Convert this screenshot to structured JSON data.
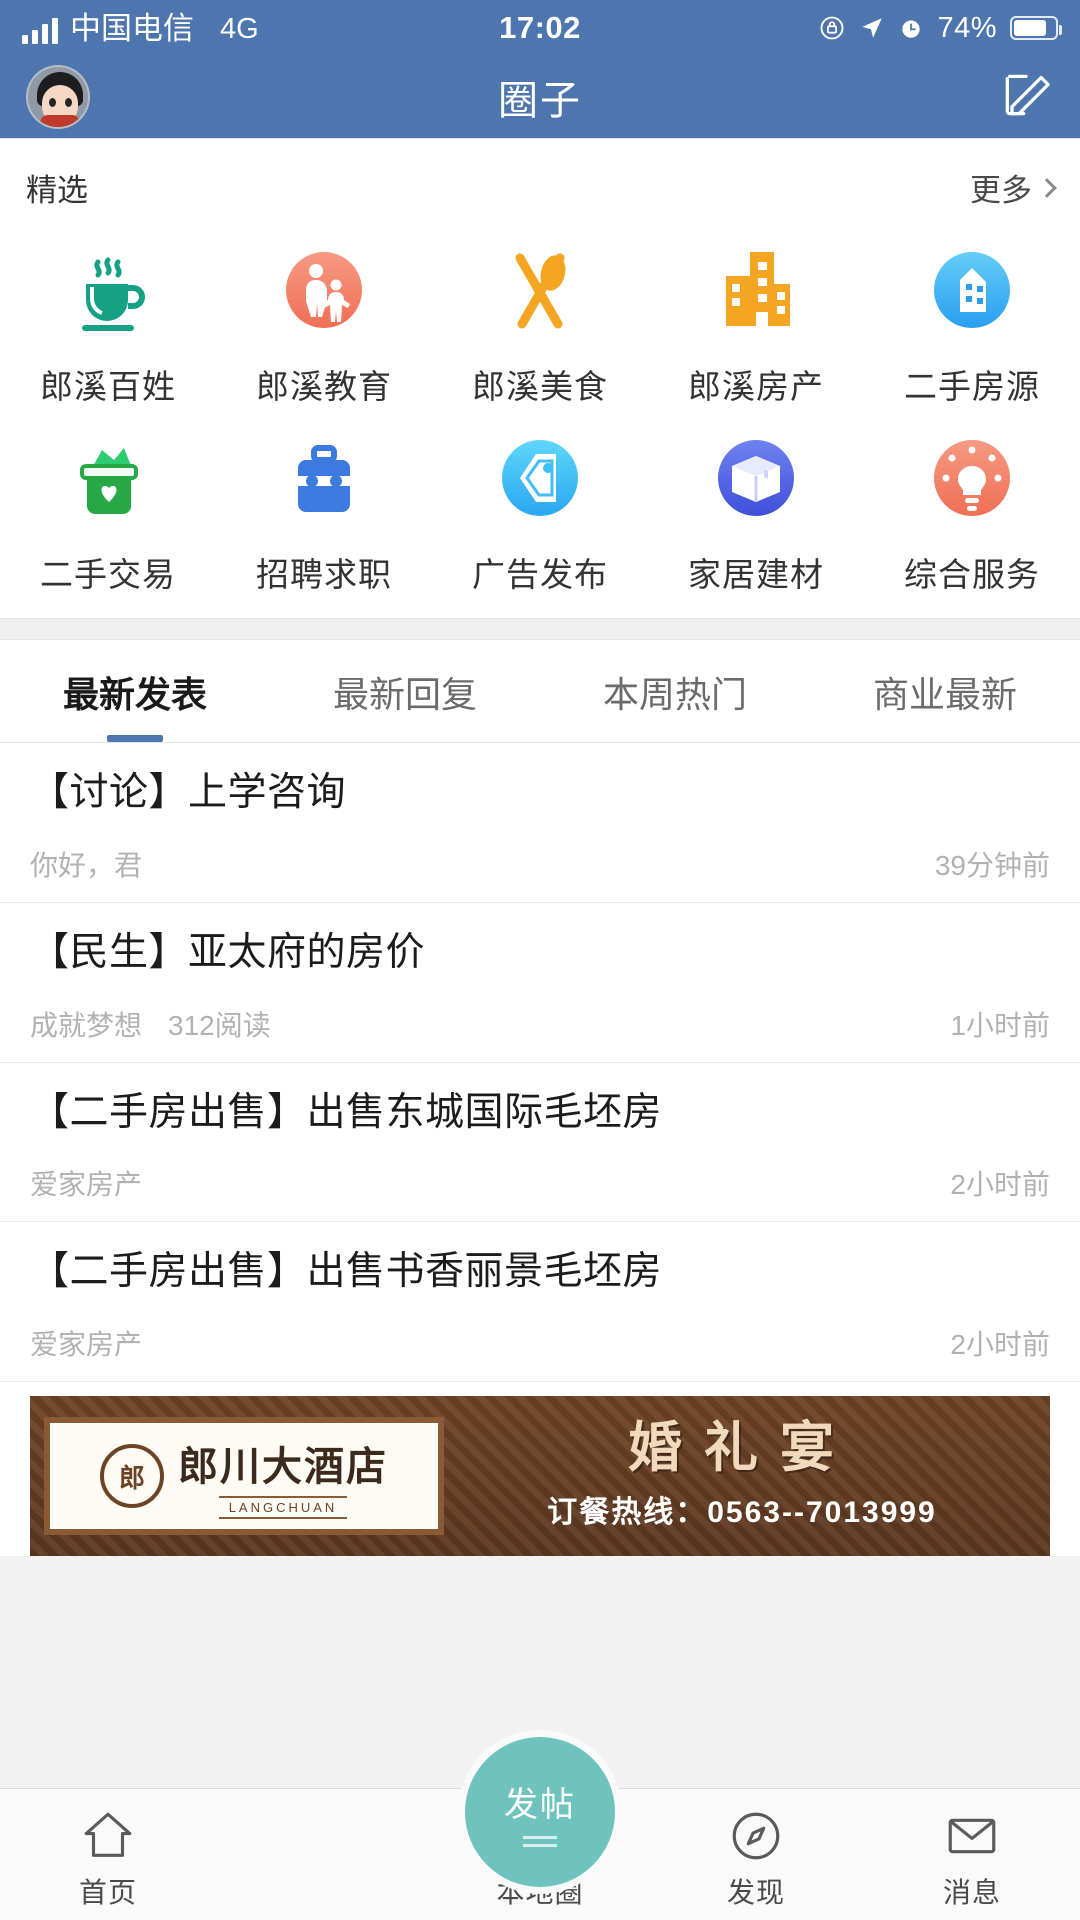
{
  "status_bar": {
    "carrier": "中国电信",
    "network": "4G",
    "time": "17:02",
    "battery_percent": "74%",
    "icons": [
      "signal-bars-icon",
      "rotation-lock-icon",
      "location-arrow-icon",
      "alarm-clock-icon",
      "battery-icon"
    ]
  },
  "nav": {
    "title": "圈子",
    "avatar_name": "user-avatar",
    "compose_icon": "compose-icon"
  },
  "featured": {
    "title": "精选",
    "more_label": "更多",
    "items": [
      {
        "label": "郎溪百姓",
        "icon": "coffee-cup-icon",
        "color": "#16a085"
      },
      {
        "label": "郎溪教育",
        "icon": "parent-child-icon",
        "color": "#f4806a"
      },
      {
        "label": "郎溪美食",
        "icon": "fork-spoon-icon",
        "color": "#f4a623"
      },
      {
        "label": "郎溪房产",
        "icon": "buildings-icon",
        "color": "#f4a623"
      },
      {
        "label": "二手房源",
        "icon": "house-circle-icon",
        "color": "#42b4f4"
      },
      {
        "label": "二手交易",
        "icon": "money-box-icon",
        "color": "#28a745"
      },
      {
        "label": "招聘求职",
        "icon": "briefcase-icon",
        "color": "#3d7ae0"
      },
      {
        "label": "广告发布",
        "icon": "price-tag-icon",
        "color": "#35bdf7"
      },
      {
        "label": "家居建材",
        "icon": "package-box-icon",
        "color": "#5063e8"
      },
      {
        "label": "综合服务",
        "icon": "lightbulb-icon",
        "color": "#f4806a"
      }
    ]
  },
  "tabs": {
    "active_index": 0,
    "items": [
      {
        "label": "最新发表"
      },
      {
        "label": "最新回复"
      },
      {
        "label": "本周热门"
      },
      {
        "label": "商业最新"
      }
    ]
  },
  "posts": [
    {
      "title": "【讨论】上学咨询",
      "author": "你好，君",
      "reads": "",
      "time": "39分钟前"
    },
    {
      "title": "【民生】亚太府的房价",
      "author": "成就梦想",
      "reads": "312阅读",
      "time": "1小时前"
    },
    {
      "title": "【二手房出售】出售东城国际毛坯房",
      "author": "爱家房产",
      "reads": "",
      "time": "2小时前"
    },
    {
      "title": "【二手房出售】出售书香丽景毛坯房",
      "author": "爱家房产",
      "reads": "",
      "time": "2小时前"
    }
  ],
  "banner": {
    "brand": "郎川大酒店",
    "brand_pinyin": "LANGCHUAN",
    "seal_text": "郎",
    "headline": "婚礼宴",
    "phone_line": "订餐热线：0563--7013999"
  },
  "bottom_nav": {
    "items": [
      {
        "label": "首页",
        "icon": "home-icon"
      },
      {
        "label": "发帖",
        "icon": "post-icon"
      },
      {
        "label": "本地圈",
        "icon": "aperture-icon"
      },
      {
        "label": "发现",
        "icon": "compass-icon"
      },
      {
        "label": "消息",
        "icon": "envelope-icon"
      }
    ],
    "accent_color": "#6ec3bf"
  }
}
